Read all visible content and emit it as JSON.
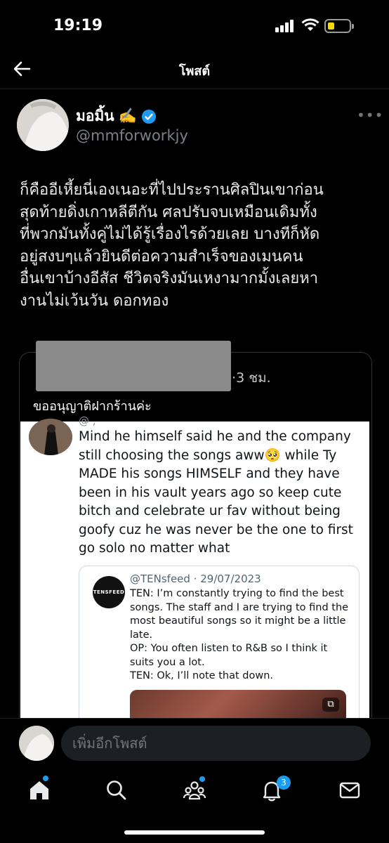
{
  "status_bar": {
    "time": "19:19"
  },
  "header": {
    "title": "โพสต์"
  },
  "post": {
    "author_name": "มอมิ้น",
    "author_emoji": "✍️",
    "author_handle": "@mmforworkjy",
    "text": "ก็คืออีเหี้ยนี่เองเนอะที่ไปประรานศิลปินเขาก่อน\nสุดท้ายดิ่งเกาหลีตีกัน ศลปรับจบเหมือนเดิมทั้ง\nที่พวกมันทั้งคู่ไม่ได้รู้เรื่องไรด้วยเลย บางทีก็หัด\nอยู่สงบๆแล้วยินดีต่อความสำเร็จของเมนคน\nอื่นเขาบ้างอีสัส ชีวิตจริงมันเหงามากมั้งเลยหา\nงานไม่เว้นวัน ดอกทอง"
  },
  "quote": {
    "meta_time": "9·3 ชม.",
    "text": "ขออนุญาติฝากร้านค่ะ",
    "screenshot": {
      "handle_partial": "@ ,",
      "reply_text": "Mind he himself said he and the company still choosing the songs aww🥺 while Ty MADE his songs HIMSELF and they have been in his vault years ago so keep cute bitch and celebrate ur fav without being goofy cuz he was never be the one to first go solo no matter what",
      "inner": {
        "logo_text": "TENSFEED",
        "head": "@TENsfeed · 29/07/2023",
        "text": "TEN: I’m constantly trying to find the best songs. The staff and I are trying to find the most beautiful songs so it might be a little late.\nOP: You often listen to R&B so I think it suits you a lot.\nTEN: Ok, I’ll note that down."
      }
    }
  },
  "composer": {
    "placeholder": "เพิ่มอีกโพสต์"
  },
  "tab_bar": {
    "items": [
      "home",
      "search",
      "communities",
      "notifications",
      "messages"
    ],
    "notification_badge": "3"
  },
  "colors": {
    "accent": "#1d9bf0",
    "background": "#000000",
    "battery": "#f5d90a"
  }
}
